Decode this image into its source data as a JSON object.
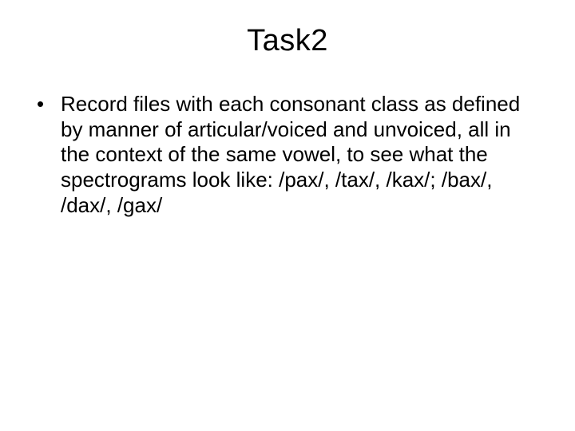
{
  "slide": {
    "title": "Task2",
    "bullets": [
      "Record files with each consonant class as defined by manner of articular/voiced and unvoiced, all in the context of the same vowel, to see what the spectrograms look like: /pax/, /tax/, /kax/; /bax/, /dax/, /gax/"
    ]
  }
}
